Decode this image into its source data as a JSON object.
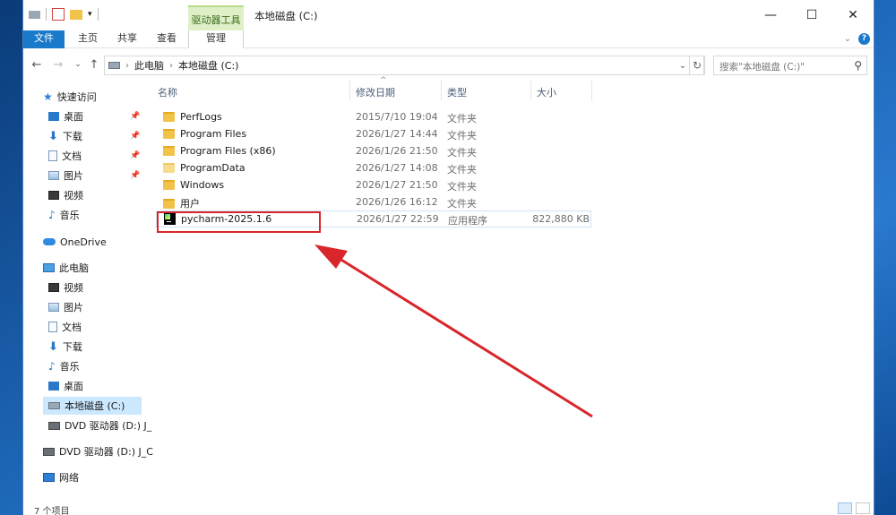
{
  "window": {
    "title": "本地磁盘 (C:)",
    "context_tab": "驱动器工具"
  },
  "ribbon": {
    "tabs": [
      "文件",
      "主页",
      "共享",
      "查看",
      "管理"
    ]
  },
  "address": {
    "crumbs": [
      "此电脑",
      "本地磁盘 (C:)"
    ],
    "search_placeholder": "搜索\"本地磁盘 (C:)\""
  },
  "nav": {
    "quick_access": "快速访问",
    "quick_items": [
      "桌面",
      "下载",
      "文档",
      "图片",
      "视频",
      "音乐"
    ],
    "onedrive": "OneDrive",
    "this_pc": "此电脑",
    "pc_items": [
      "视频",
      "图片",
      "文档",
      "下载",
      "音乐",
      "桌面",
      "本地磁盘 (C:)",
      "DVD 驱动器 (D:) J_"
    ],
    "dvd": "DVD 驱动器 (D:) J_C",
    "network": "网络"
  },
  "columns": {
    "name": "名称",
    "date": "修改日期",
    "type": "类型",
    "size": "大小"
  },
  "files": [
    {
      "name": "PerfLogs",
      "date": "2015/7/10 19:04",
      "type": "文件夹",
      "size": ""
    },
    {
      "name": "Program Files",
      "date": "2026/1/27 14:44",
      "type": "文件夹",
      "size": ""
    },
    {
      "name": "Program Files (x86)",
      "date": "2026/1/26 21:50",
      "type": "文件夹",
      "size": ""
    },
    {
      "name": "ProgramData",
      "date": "2026/1/27 14:08",
      "type": "文件夹",
      "size": ""
    },
    {
      "name": "Windows",
      "date": "2026/1/27 21:50",
      "type": "文件夹",
      "size": ""
    },
    {
      "name": "用户",
      "date": "2026/1/26 16:12",
      "type": "文件夹",
      "size": ""
    },
    {
      "name": "pycharm-2025.1.6",
      "date": "2026/1/27 22:59",
      "type": "应用程序",
      "size": "822,880 KB"
    }
  ],
  "status": {
    "item_count": "7 个项目"
  },
  "annotation": {
    "color": "#d8262a"
  }
}
